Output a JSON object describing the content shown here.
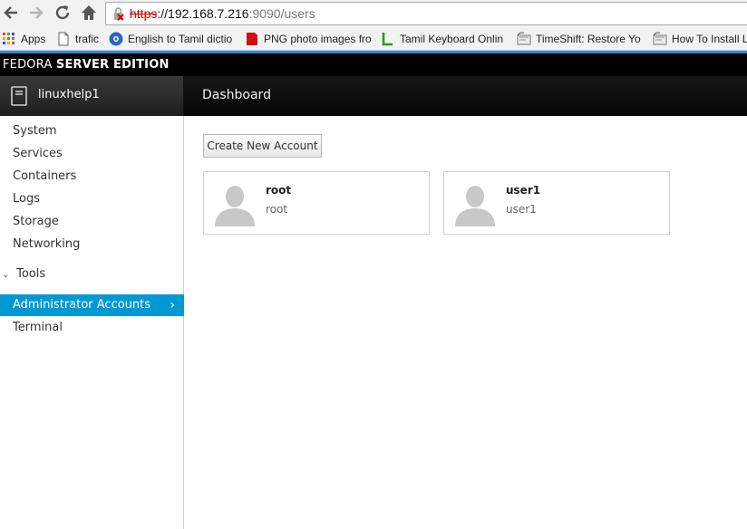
{
  "browser": {
    "url_scheme": "https",
    "url_host": "://192.168.7.216",
    "url_rest": ":9090/users",
    "bookmarks": [
      {
        "label": "Apps",
        "icon": "apps-grid-icon"
      },
      {
        "label": "trafic",
        "icon": "page-icon"
      },
      {
        "label": "English to Tamil dictio",
        "icon": "dictionary-icon"
      },
      {
        "label": "PNG photo images fro",
        "icon": "png-icon"
      },
      {
        "label": "Tamil Keyboard Onlin",
        "icon": "keyboard-icon"
      },
      {
        "label": "TimeShift: Restore Yo",
        "icon": "timeshift-icon"
      },
      {
        "label": "How To Install L",
        "icon": "install-icon"
      }
    ]
  },
  "brand": {
    "light": "FEDORA ",
    "bold": "SERVER EDITION"
  },
  "host": {
    "name": "linuxhelp1"
  },
  "topnav": {
    "dashboard": "Dashboard"
  },
  "sidebar": {
    "items": [
      "System",
      "Services",
      "Containers",
      "Logs",
      "Storage",
      "Networking"
    ],
    "tools_label": "Tools",
    "tools_items": [
      "Administrator Accounts",
      "Terminal"
    ],
    "active": "Administrator Accounts"
  },
  "main": {
    "create_button": "Create New Account",
    "accounts": [
      {
        "name": "root",
        "login": "root"
      },
      {
        "name": "user1",
        "login": "user1"
      }
    ]
  },
  "colors": {
    "accent": "#0099d3",
    "bluebar": "#2a8fd4"
  }
}
